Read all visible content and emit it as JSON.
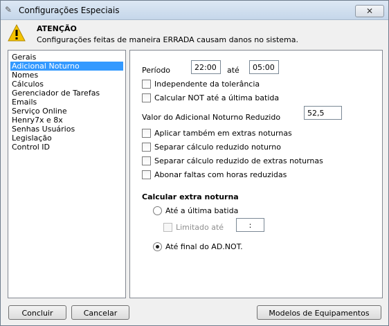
{
  "window": {
    "title": "Configurações Especiais",
    "close_label": "✕"
  },
  "warning": {
    "title": "ATENÇÃO",
    "message": "Configurações feitas de maneira ERRADA causam danos no sistema."
  },
  "categories": [
    {
      "label": "Gerais",
      "selected": false
    },
    {
      "label": "Adicional Noturno",
      "selected": true
    },
    {
      "label": "Nomes",
      "selected": false
    },
    {
      "label": "Cálculos",
      "selected": false
    },
    {
      "label": "Gerenciador de Tarefas",
      "selected": false
    },
    {
      "label": "Emails",
      "selected": false
    },
    {
      "label": "Serviço Online",
      "selected": false
    },
    {
      "label": "Henry7x e 8x",
      "selected": false
    },
    {
      "label": "Senhas Usuários",
      "selected": false
    },
    {
      "label": "Legislação",
      "selected": false
    },
    {
      "label": "Control ID",
      "selected": false
    }
  ],
  "settings": {
    "periodo_label": "Período",
    "periodo_inicio": "22:00",
    "ate_label": "até",
    "periodo_fim": "05:00",
    "independente_tolerancia": {
      "label": "Independente da tolerância",
      "checked": false
    },
    "calcular_not": {
      "label": "Calcular NOT até a última batida",
      "checked": false
    },
    "valor_label": "Valor do Adicional Noturno Reduzido",
    "valor": "52,5",
    "aplicar_extras": {
      "label": "Aplicar também em extras noturnas",
      "checked": false
    },
    "separar_reduzido": {
      "label": "Separar cálculo reduzido noturno",
      "checked": false
    },
    "separar_extras": {
      "label": "Separar cálculo reduzido de extras noturnas",
      "checked": false
    },
    "abonar_faltas": {
      "label": "Abonar faltas com horas reduzidas",
      "checked": false
    },
    "calc_extra_heading": "Calcular extra noturna",
    "radio_ultima": {
      "label": "Até a última batida",
      "selected": false
    },
    "limitado": {
      "label": "Limitado até",
      "checked": false,
      "enabled": false
    },
    "limitado_value": ":",
    "radio_final": {
      "label": "Até final do AD.NOT.",
      "selected": true
    }
  },
  "buttons": {
    "concluir": "Concluir",
    "cancelar": "Cancelar",
    "modelos": "Modelos de Equipamentos"
  }
}
